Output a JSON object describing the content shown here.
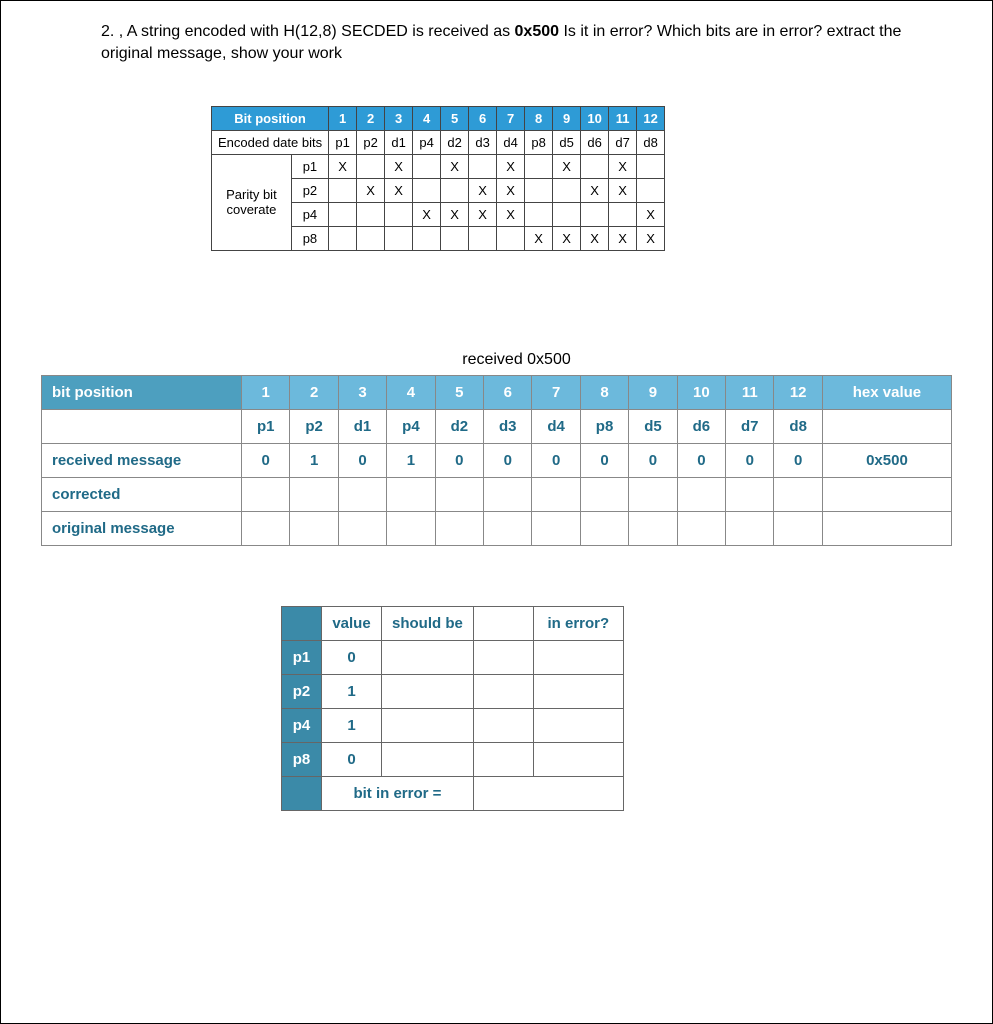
{
  "problem": {
    "number": "2.",
    "text_pre_bold": ", A string encoded with H(12,8) SECDED is received as ",
    "bold": "0x500",
    "text_post_bold": " Is it in error? Which bits are in error? extract the original message, show your work"
  },
  "coverage_table": {
    "header_label": "Bit position",
    "positions": [
      "1",
      "2",
      "3",
      "4",
      "5",
      "6",
      "7",
      "8",
      "9",
      "10",
      "11",
      "12"
    ],
    "row_encoded": {
      "label": "Encoded date bits",
      "cells": [
        "p1",
        "p2",
        "d1",
        "p4",
        "d2",
        "d3",
        "d4",
        "p8",
        "d5",
        "d6",
        "d7",
        "d8"
      ]
    },
    "parity_group_label": "Parity bit coverate",
    "rows": [
      {
        "name": "p1",
        "marks": [
          "X",
          "",
          "X",
          "",
          "X",
          "",
          "X",
          "",
          "X",
          "",
          "X",
          ""
        ]
      },
      {
        "name": "p2",
        "marks": [
          "",
          "X",
          "X",
          "",
          "",
          "X",
          "X",
          "",
          "",
          "X",
          "X",
          ""
        ]
      },
      {
        "name": "p4",
        "marks": [
          "",
          "",
          "",
          "X",
          "X",
          "X",
          "X",
          "",
          "",
          "",
          "",
          "X"
        ]
      },
      {
        "name": "p8",
        "marks": [
          "",
          "",
          "",
          "",
          "",
          "",
          "",
          "X",
          "X",
          "X",
          "X",
          "X"
        ]
      }
    ]
  },
  "worksheet": {
    "title": "received 0x500",
    "header_label": "bit position",
    "positions": [
      "1",
      "2",
      "3",
      "4",
      "5",
      "6",
      "7",
      "8",
      "9",
      "10",
      "11",
      "12"
    ],
    "hex_header": "hex value",
    "type_row": [
      "p1",
      "p2",
      "d1",
      "p4",
      "d2",
      "d3",
      "d4",
      "p8",
      "d5",
      "d6",
      "d7",
      "d8"
    ],
    "rows": [
      {
        "label": "received message",
        "cells": [
          "0",
          "1",
          "0",
          "1",
          "0",
          "0",
          "0",
          "0",
          "0",
          "0",
          "0",
          "0"
        ],
        "hex": "0x500"
      },
      {
        "label": "corrected",
        "cells": [
          "",
          "",
          "",
          "",
          "",
          "",
          "",
          "",
          "",
          "",
          "",
          ""
        ],
        "hex": ""
      },
      {
        "label": "original message",
        "cells": [
          "",
          "",
          "",
          "",
          "",
          "",
          "",
          "",
          "",
          "",
          "",
          ""
        ],
        "hex": ""
      }
    ]
  },
  "parity_check": {
    "headers": [
      "value",
      "should be",
      "",
      "in error?"
    ],
    "rows": [
      {
        "name": "p1",
        "value": "0",
        "should_be": "",
        "blank": "",
        "in_error": ""
      },
      {
        "name": "p2",
        "value": "1",
        "should_be": "",
        "blank": "",
        "in_error": ""
      },
      {
        "name": "p4",
        "value": "1",
        "should_be": "",
        "blank": "",
        "in_error": ""
      },
      {
        "name": "p8",
        "value": "0",
        "should_be": "",
        "blank": "",
        "in_error": ""
      }
    ],
    "footer_label": "bit in error =",
    "footer_value": ""
  }
}
